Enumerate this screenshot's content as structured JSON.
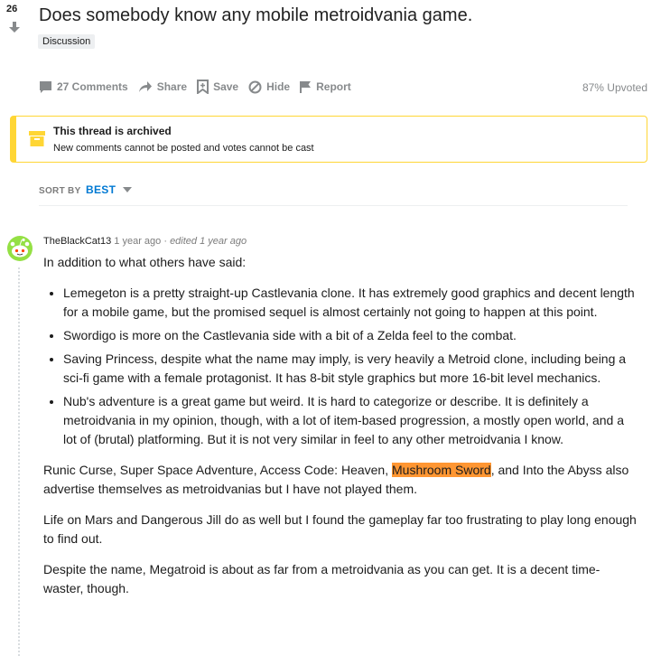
{
  "post": {
    "score": "26",
    "title": "Does somebody know any mobile metroidvania game.",
    "flair": "Discussion",
    "upvoted": "87% Upvoted"
  },
  "actions": {
    "comments": "27 Comments",
    "share": "Share",
    "save": "Save",
    "hide": "Hide",
    "report": "Report"
  },
  "archived": {
    "title": "This thread is archived",
    "subtitle": "New comments cannot be posted and votes cannot be cast",
    "accent_color": "#ffd635"
  },
  "sort": {
    "label": "SORT BY",
    "value": "BEST"
  },
  "comment": {
    "author": "TheBlackCat13",
    "time": "1 year ago",
    "separator": "·",
    "edited": "edited 1 year ago",
    "intro": "In addition to what others have said:",
    "bullets": [
      "Lemegeton is a pretty straight-up Castlevania clone. It has extremely good graphics and decent length for a mobile game, but the promised sequel is almost certainly not going to happen at this point.",
      "Swordigo is more on the Castlevania side with a bit of a Zelda feel to the combat.",
      "Saving Princess, despite what the name may imply, is very heavily a Metroid clone, including being a sci-fi game with a female protagonist. It has 8-bit style graphics but more 16-bit level mechanics.",
      "Nub's adventure is a great game but weird. It is hard to categorize or describe. It is definitely a metroidvania in my opinion, though, with a lot of item-based progression, a mostly open world, and a lot of (brutal) platforming. But it is not very similar in feel to any other metroidvania I know."
    ],
    "para1_before": "Runic Curse, Super Space Adventure, Access Code: Heaven, ",
    "para1_highlight": "Mushroom Sword",
    "para1_after": ", and Into the Abyss also advertise themselves as metroidvanias but I have not played them.",
    "para2": "Life on Mars and Dangerous Jill do as well but I found the gameplay far too frustrating to play long enough to find out.",
    "para3": "Despite the name, Megatroid is about as far from a metroidvania as you can get. It is a decent time-waster, though."
  },
  "colors": {
    "link_blue": "#0079d3",
    "meta_gray": "#878a8c",
    "highlight": "#ff9632"
  },
  "icons": [
    "downvote-arrow-icon",
    "comment-icon",
    "share-icon",
    "save-icon",
    "hide-icon",
    "report-flag-icon",
    "archive-box-icon",
    "caret-down-icon",
    "snoo-avatar-icon"
  ]
}
